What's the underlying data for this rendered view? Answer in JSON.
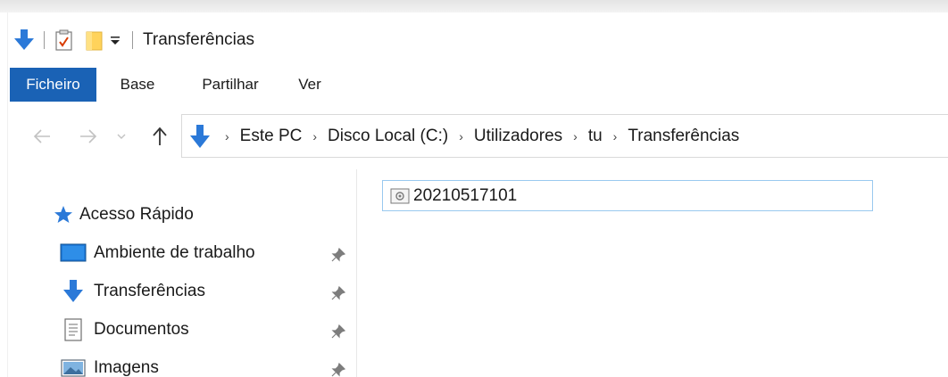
{
  "window": {
    "title": "Transferências"
  },
  "quick_access_toolbar": {
    "icons": [
      "downloads-arrow-icon",
      "properties-icon",
      "new-folder-icon",
      "customize-dropdown-icon"
    ]
  },
  "ribbon": {
    "tabs": [
      {
        "label": "Ficheiro",
        "active": true
      },
      {
        "label": "Base"
      },
      {
        "label": "Partilhar"
      },
      {
        "label": "Ver"
      }
    ]
  },
  "address_bar": {
    "breadcrumbs": [
      "Este PC",
      "Disco Local (C:)",
      "Utilizadores",
      "tu",
      "Transferências"
    ]
  },
  "nav_pane": {
    "quick_access_label": "Acesso Rápido",
    "items": [
      {
        "label": "Ambiente de trabalho",
        "icon": "desktop-icon",
        "pinned": true
      },
      {
        "label": "Transferências",
        "icon": "downloads-icon",
        "pinned": true
      },
      {
        "label": "Documentos",
        "icon": "documents-icon",
        "pinned": true
      },
      {
        "label": "Imagens",
        "icon": "pictures-icon",
        "pinned": true
      }
    ]
  },
  "content": {
    "files": [
      {
        "name": "20210517101",
        "icon": "settings-file-icon"
      }
    ]
  },
  "colors": {
    "accent": "#1a62b5",
    "selection_border": "#99c9ef",
    "download_blue": "#2b79d8"
  }
}
